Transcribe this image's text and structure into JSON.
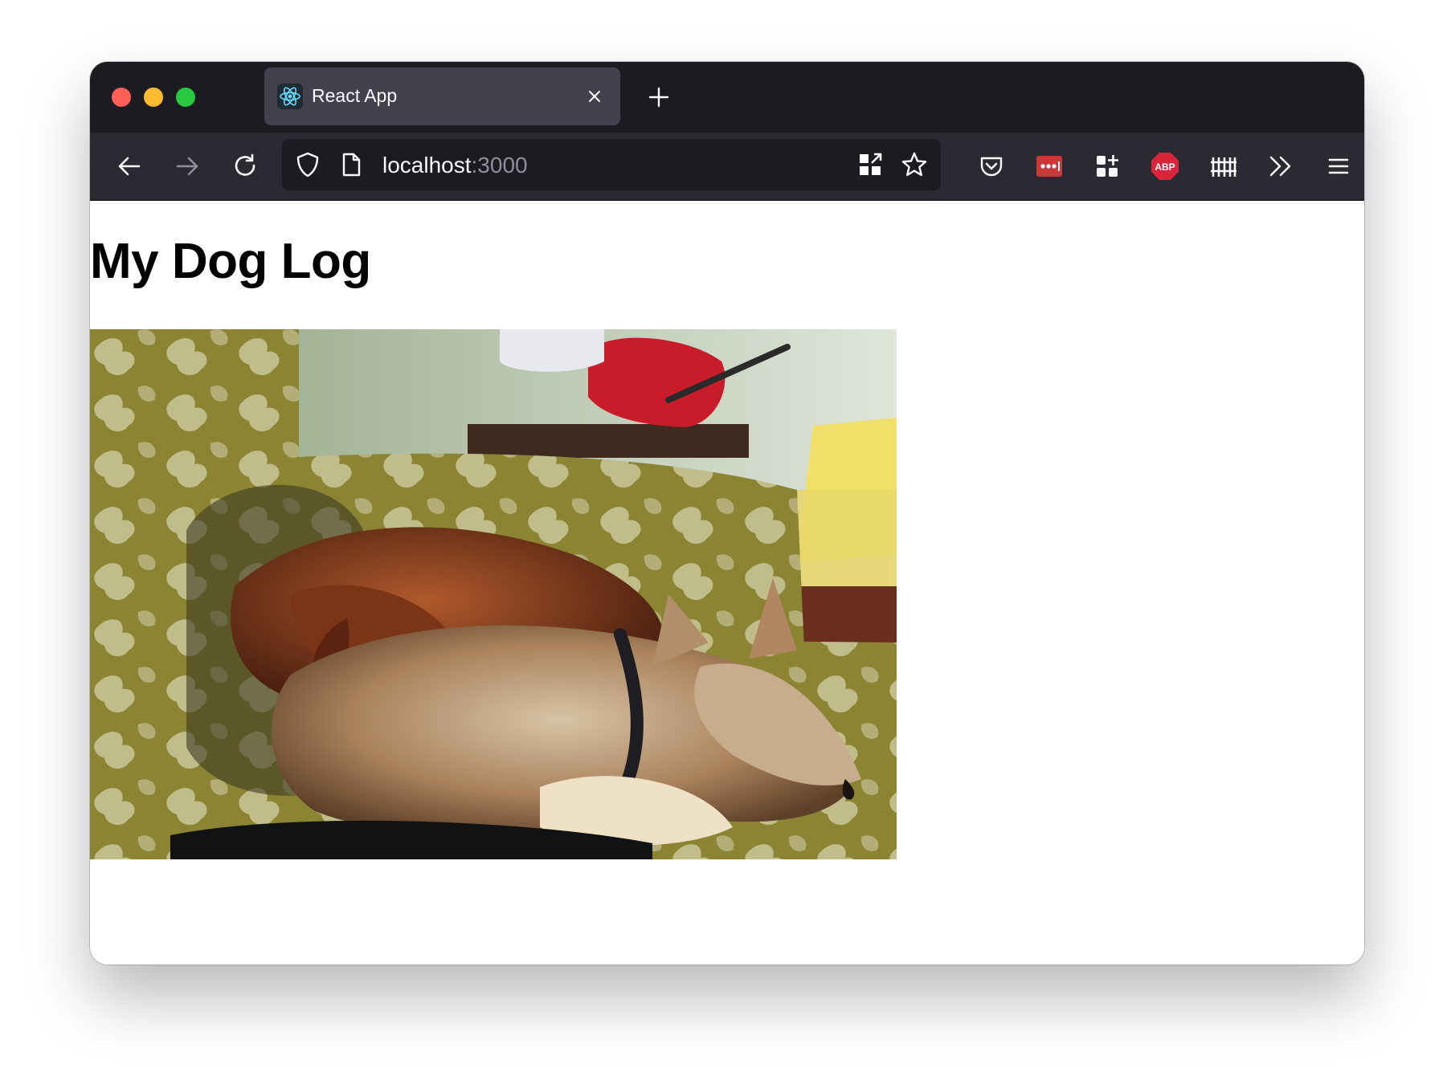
{
  "browser": {
    "tab": {
      "title": "React App",
      "icon": "react-logo-icon"
    },
    "address": {
      "host": "localhost",
      "port": ":3000"
    },
    "toolbar_icons": [
      "back-icon",
      "forward-icon",
      "reload-icon",
      "shield-icon",
      "page-icon",
      "qr-code-icon",
      "bookmark-star-icon",
      "pocket-icon",
      "lastpass-icon",
      "extensions-grid-icon",
      "adblock-plus-icon",
      "fence-icon",
      "overflow-chevrons-icon",
      "hamburger-menu-icon"
    ],
    "abp_label": "ABP"
  },
  "page": {
    "heading": "My Dog Log",
    "image": {
      "subject": "two dogs sleeping on a floral couch"
    }
  },
  "colors": {
    "titlebar": "#1c1b22",
    "toolbar": "#2b2a33",
    "tab_active": "#42414d",
    "close": "#fe5f57",
    "minimize": "#febc2e",
    "maximize": "#28c840",
    "abp_red": "#d9243a",
    "lastpass_red": "#c83a3a"
  }
}
